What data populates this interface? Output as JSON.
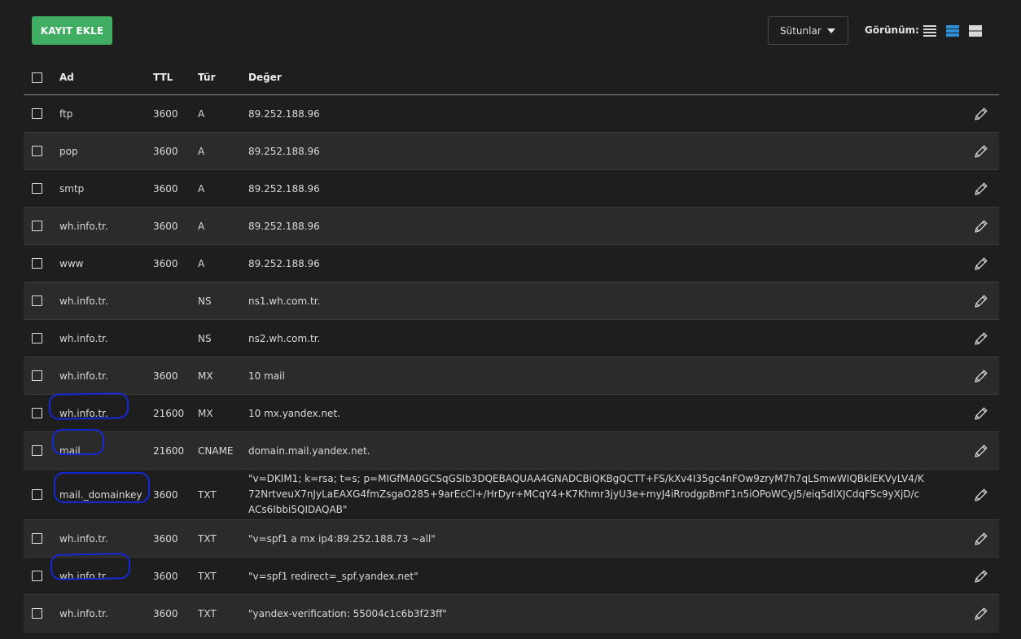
{
  "toolbar": {
    "add_label": "KAYIT EKLE",
    "columns_label": "Sütunlar",
    "view_label": "Görünüm:"
  },
  "table": {
    "headers": {
      "name": "Ad",
      "ttl": "TTL",
      "type": "Tür",
      "value": "Değer"
    },
    "rows": [
      {
        "name": "ftp",
        "ttl": "3600",
        "type": "A",
        "value": "89.252.188.96"
      },
      {
        "name": "pop",
        "ttl": "3600",
        "type": "A",
        "value": "89.252.188.96"
      },
      {
        "name": "smtp",
        "ttl": "3600",
        "type": "A",
        "value": "89.252.188.96"
      },
      {
        "name": "wh.info.tr.",
        "ttl": "3600",
        "type": "A",
        "value": "89.252.188.96"
      },
      {
        "name": "www",
        "ttl": "3600",
        "type": "A",
        "value": "89.252.188.96"
      },
      {
        "name": "wh.info.tr.",
        "ttl": "",
        "type": "NS",
        "value": "ns1.wh.com.tr."
      },
      {
        "name": "wh.info.tr.",
        "ttl": "",
        "type": "NS",
        "value": "ns2.wh.com.tr."
      },
      {
        "name": "wh.info.tr.",
        "ttl": "3600",
        "type": "MX",
        "value": "10 mail"
      },
      {
        "name": "wh.info.tr.",
        "ttl": "21600",
        "type": "MX",
        "value": "10 mx.yandex.net."
      },
      {
        "name": "mail",
        "ttl": "21600",
        "type": "CNAME",
        "value": "domain.mail.yandex.net."
      },
      {
        "name": "mail._domainkey",
        "ttl": "3600",
        "type": "TXT",
        "value": "\"v=DKIM1; k=rsa; t=s; p=MIGfMA0GCSqGSIb3DQEBAQUAA4GNADCBiQKBgQCTT+FS/kXv4I35gc4nFOw9zryM7h7qLSmwWIQBklEKVyLV4/K72NrtveuX7nJyLaEAXG4fmZsgaO285+9arEcCl+/HrDyr+MCqY4+K7Khmr3jyU3e+myJ4iRrodgpBmF1n5iOPoWCyJ5/eiq5dIXJCdqFSc9yXjD/cACs6Ibbi5QIDAQAB\""
      },
      {
        "name": "wh.info.tr.",
        "ttl": "3600",
        "type": "TXT",
        "value": "\"v=spf1 a mx ip4:89.252.188.73 ~all\""
      },
      {
        "name": "wh.info.tr.",
        "ttl": "3600",
        "type": "TXT",
        "value": "\"v=spf1 redirect=_spf.yandex.net\""
      },
      {
        "name": "wh.info.tr.",
        "ttl": "3600",
        "type": "TXT",
        "value": "\"yandex-verification: 55004c1c6b3f23ff\""
      }
    ]
  },
  "annotations": {
    "color": "#1428d6"
  },
  "colors": {
    "background": "#1e1e1e",
    "row_alt": "#2b2b2b",
    "add_button": "#3fae62",
    "view_active": "#2f8fd8"
  },
  "icons": {
    "edit": "pencil-icon",
    "view_compact": "list-compact-icon",
    "view_normal": "list-normal-icon",
    "view_wide": "list-wide-icon",
    "dropdown": "caret-down-icon"
  }
}
